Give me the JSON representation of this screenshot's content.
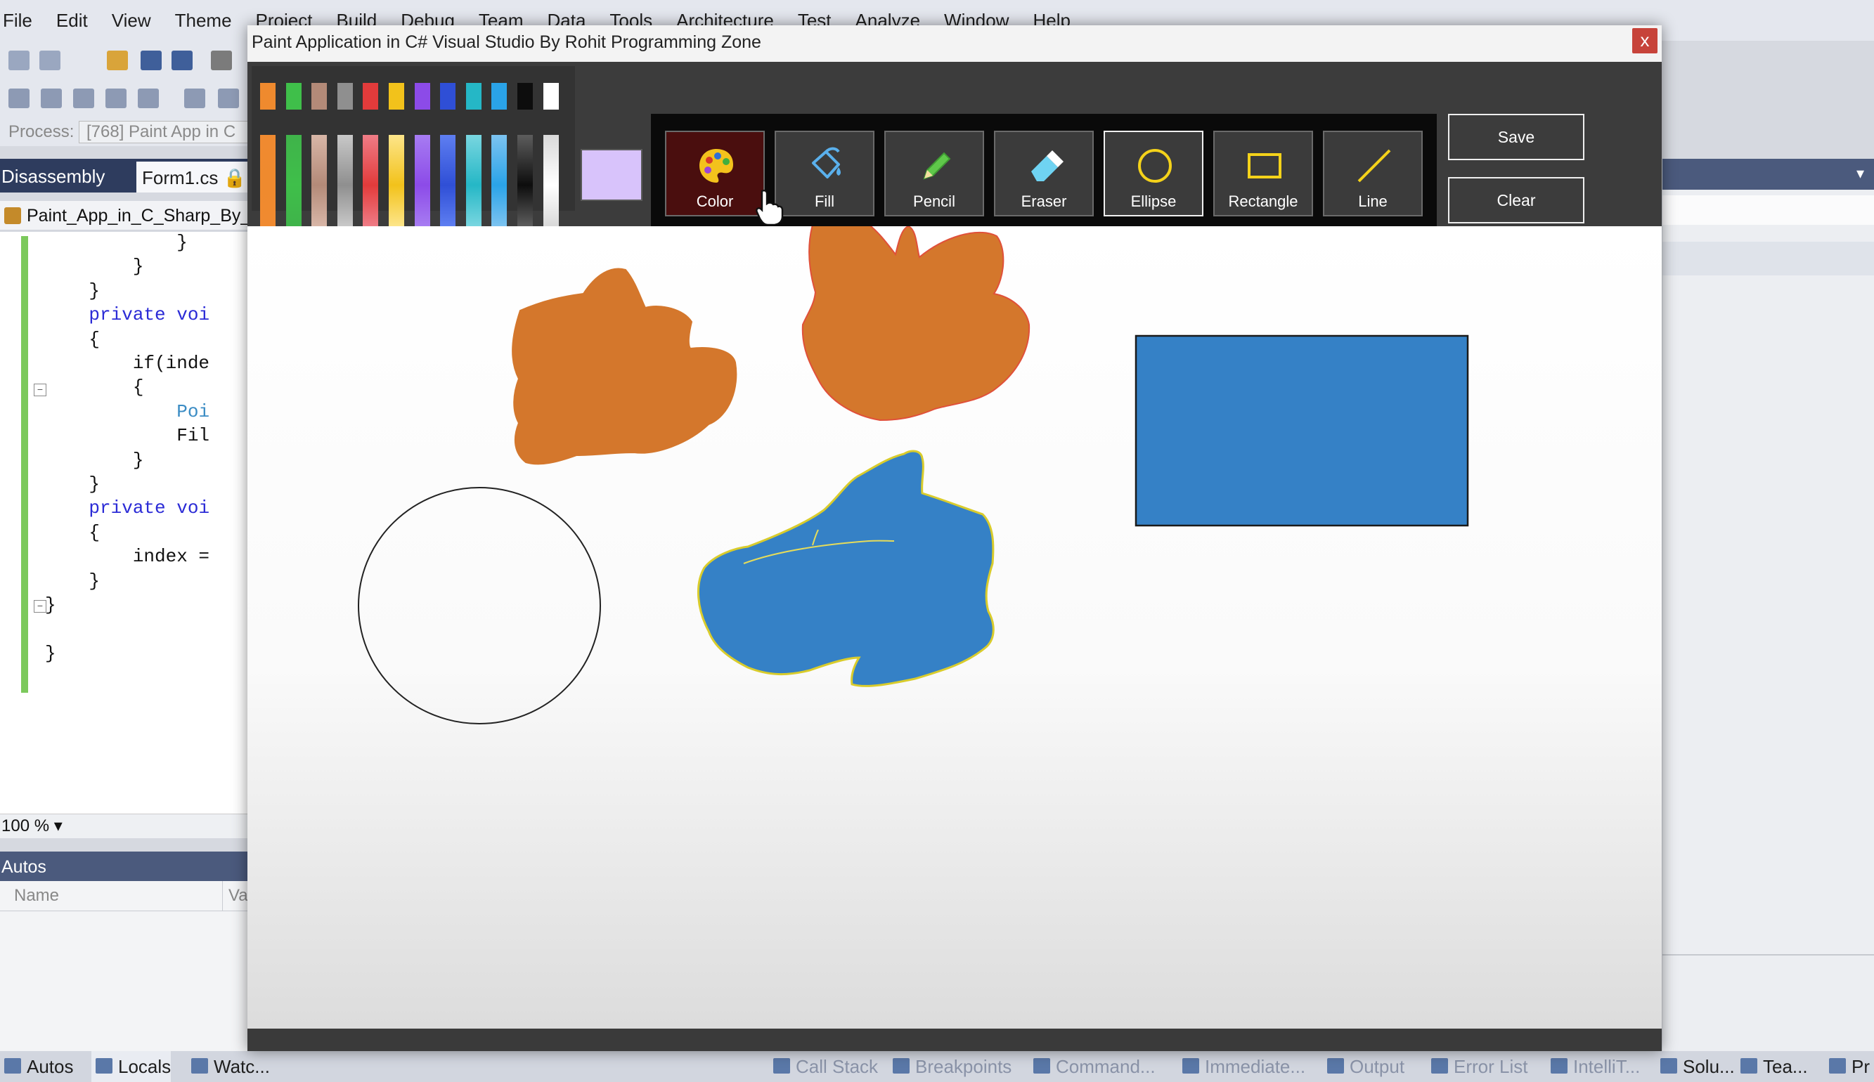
{
  "ide": {
    "menu": [
      "File",
      "Edit",
      "View",
      "Theme",
      "Project",
      "Build",
      "Debug",
      "Team",
      "Data",
      "Tools",
      "Architecture",
      "Test",
      "Analyze",
      "Window",
      "Help"
    ],
    "process_label": "Process:",
    "process_value": "[768] Paint App in C",
    "tabs": {
      "disassembly": "Disassembly",
      "form1": "Form1.cs 🔒"
    },
    "nav_dropdown": "Paint_App_in_C_Sharp_By_R",
    "code": [
      {
        "t": "            }"
      },
      {
        "t": "        }"
      },
      {
        "t": "    }"
      },
      {
        "kw": "private voi",
        "pre": "    "
      },
      {
        "t": "    {"
      },
      {
        "t": "        if(inde"
      },
      {
        "t": "        {"
      },
      {
        "pl": "Poi",
        "pre": "            "
      },
      {
        "t": "            Fil"
      },
      {
        "t": "        }"
      },
      {
        "t": "    }"
      },
      {
        "kw": "private voi",
        "pre": "    "
      },
      {
        "t": "    {"
      },
      {
        "t": "        index ="
      },
      {
        "t": "    }"
      },
      {
        "t": "}"
      },
      {
        "t": ""
      },
      {
        "t": "}"
      }
    ],
    "zoom": "100 %",
    "autos_title": "Autos",
    "autos_col_name": "Name",
    "autos_col_value": "Va",
    "bottom_tabs": [
      "Autos",
      "Locals",
      "Watc...",
      "Call Stack",
      "Breakpoints",
      "Command...",
      "Immediate...",
      "Output",
      "Error List",
      "IntelliT...",
      "Solu...",
      "Tea...",
      "Pr"
    ]
  },
  "paint": {
    "title": "Paint Application in C# Visual Studio By Rohit Programming Zone",
    "close": "x",
    "palette_colors": [
      "#ef8a2e",
      "#3fbf4a",
      "#b38a78",
      "#8f8f8f",
      "#e23b3b",
      "#f2c21b",
      "#8c4be8",
      "#2f4fd6",
      "#25b7c6",
      "#2aa3e8",
      "#0d0d0d",
      "#ffffff"
    ],
    "palette_shade_tops": [
      "#f08a30",
      "#3fb34a",
      "#d8b6a7",
      "#c8c8c8",
      "#ef7c86",
      "#fde58a",
      "#a77cf2",
      "#5e7ef1",
      "#79d6e0",
      "#7cc3f0",
      "#5d5d5d",
      "#d9d9d9"
    ],
    "current_color": "#d8c3fb",
    "tools": [
      {
        "name": "Color",
        "icon": "palette-icon"
      },
      {
        "name": "Fill",
        "icon": "fill-bucket-icon"
      },
      {
        "name": "Pencil",
        "icon": "pencil-icon"
      },
      {
        "name": "Eraser",
        "icon": "eraser-icon"
      },
      {
        "name": "Ellipse",
        "icon": "ellipse-icon"
      },
      {
        "name": "Rectangle",
        "icon": "rectangle-icon"
      },
      {
        "name": "Line",
        "icon": "line-icon"
      }
    ],
    "selected_tool": "Ellipse",
    "buttons": {
      "save": "Save",
      "clear": "Clear"
    },
    "canvas_shapes": {
      "blob_fill_1": "#d4772c",
      "blob_fill_2": "#d4772c",
      "blob_fill_3": "#3581c6",
      "rectangle_fill": "#3581c6"
    }
  }
}
